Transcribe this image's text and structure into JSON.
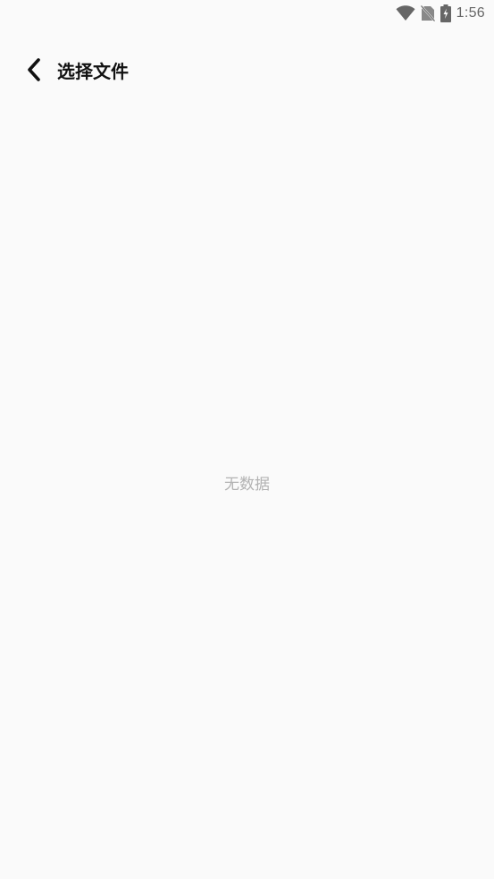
{
  "status_bar": {
    "time": "1:56",
    "icons": [
      "wifi-icon",
      "no-sim-icon",
      "battery-charging-icon"
    ]
  },
  "header": {
    "back_icon": "chevron-left-icon",
    "title": "选择文件"
  },
  "content": {
    "empty_message": "无数据"
  },
  "colors": {
    "background": "#fafafa",
    "title": "#111111",
    "empty_text": "#b2b2b2",
    "status": "#666666"
  }
}
